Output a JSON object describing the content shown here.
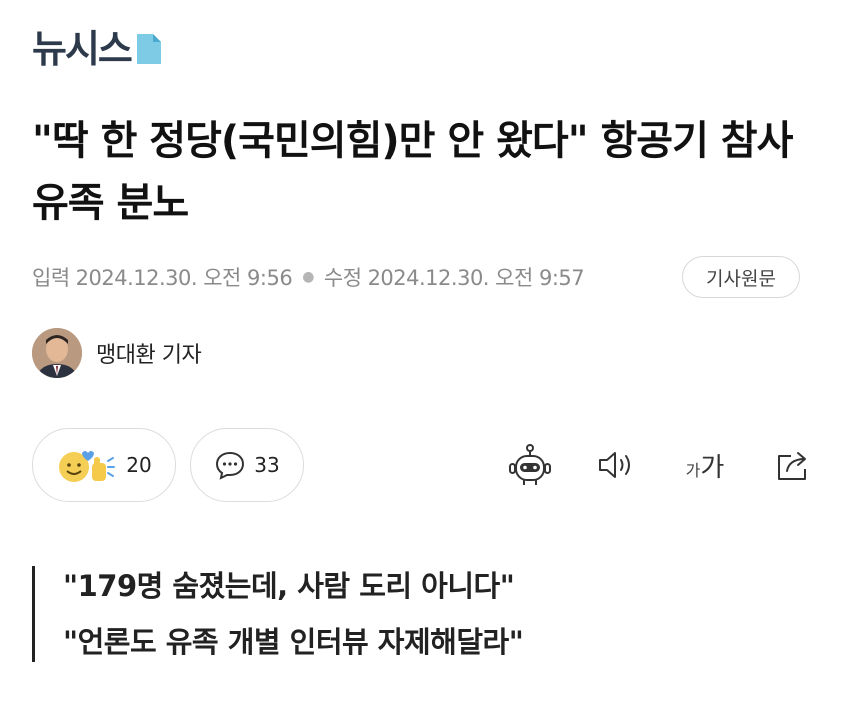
{
  "brand": {
    "name": "뉴시스",
    "accent": "#6fc3e0"
  },
  "article": {
    "headline": "\"딱 한 정당(국민의힘)만 안 왔다\" 항공기 참사 유족 분노",
    "published_label": "입력",
    "published": "2024.12.30. 오전 9:56",
    "modified_label": "수정",
    "modified": "2024.12.30. 오전 9:57",
    "original_button": "기사원문",
    "reporter": "맹대환 기자"
  },
  "actions": {
    "reactions_count": "20",
    "comments_count": "33",
    "font_size_small": "가",
    "font_size_large": "가"
  },
  "icons": [
    "reaction-emoji-icon",
    "comment-icon",
    "robot-summary-icon",
    "speaker-icon",
    "font-size-icon",
    "share-icon"
  ],
  "summary": [
    "\"179명 숨졌는데, 사람 도리 아니다\"",
    "\"언론도 유족 개별 인터뷰 자제해달라\""
  ]
}
